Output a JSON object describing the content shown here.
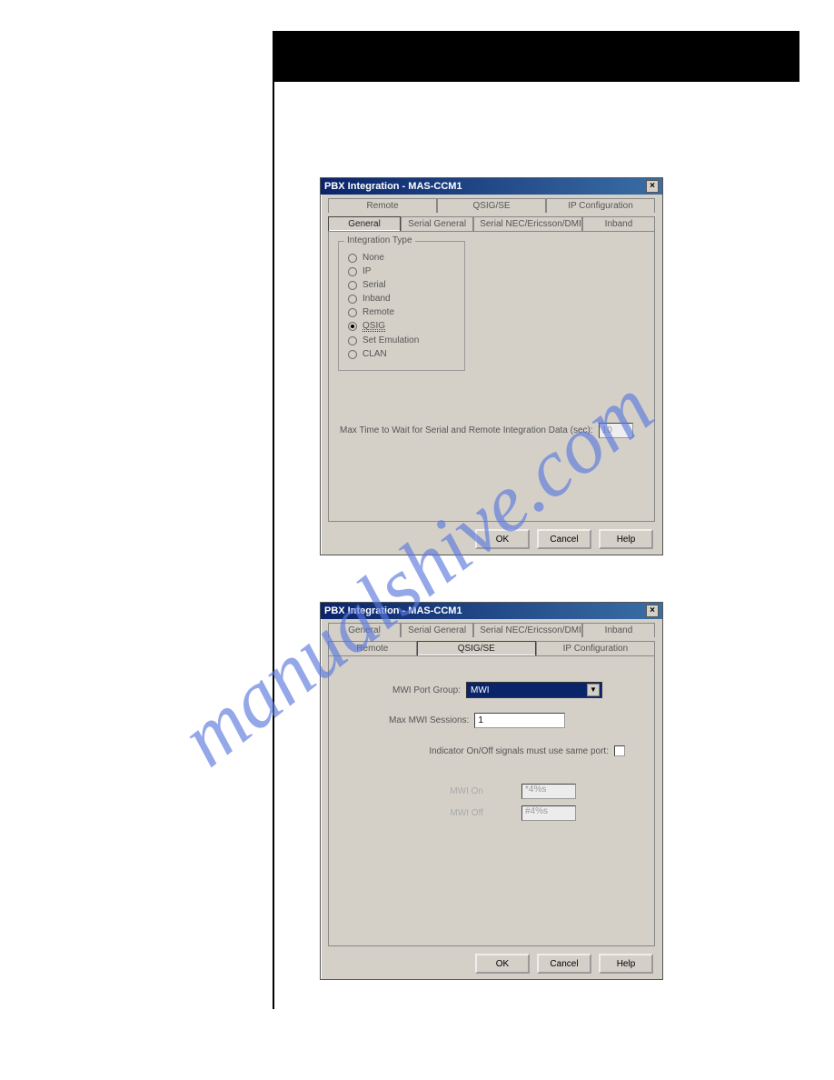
{
  "watermark": "manualshive.com",
  "dialog1": {
    "title": "PBX Integration - MAS-CCM1",
    "tabs_row1": [
      "Remote",
      "QSIG/SE",
      "IP Configuration"
    ],
    "tabs_row2": [
      "General",
      "Serial General",
      "Serial NEC/Ericsson/DMID",
      "Inband"
    ],
    "active_tab": "General",
    "groupbox_title": "Integration Type",
    "radios": [
      "None",
      "IP",
      "Serial",
      "Inband",
      "Remote",
      "QSIG",
      "Set Emulation",
      "CLAN"
    ],
    "selected_radio": "QSIG",
    "max_time_label": "Max Time to Wait for Serial and Remote Integration Data (sec):",
    "max_time_value": "10",
    "buttons": [
      "OK",
      "Cancel",
      "Help"
    ]
  },
  "dialog2": {
    "title": "PBX Integration - MAS-CCM1",
    "tabs_row1": [
      "General",
      "Serial General",
      "Serial NEC/Ericsson/DMID",
      "Inband"
    ],
    "tabs_row2": [
      "Remote",
      "QSIG/SE",
      "IP Configuration"
    ],
    "active_tab": "QSIG/SE",
    "mwi_port_group_label": "MWI Port Group:",
    "mwi_port_group_value": "MWI",
    "max_mwi_label": "Max MWI Sessions:",
    "max_mwi_value": "1",
    "indicator_label": "Indicator On/Off signals must use same port:",
    "mwi_on_label": "MWI On",
    "mwi_on_value": "*4%s",
    "mwi_off_label": "MWI Off",
    "mwi_off_value": "#4%s",
    "buttons": [
      "OK",
      "Cancel",
      "Help"
    ]
  }
}
